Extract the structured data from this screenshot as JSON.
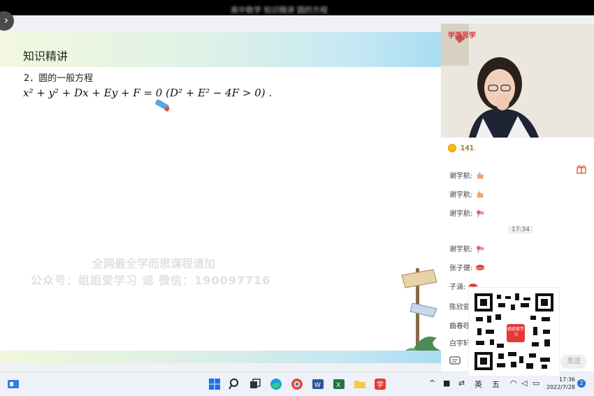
{
  "window": {
    "title": "高中数学 知识精讲 圆的方程"
  },
  "slide": {
    "header_title": "知识精讲",
    "section_heading": "2．圆的一般方程",
    "formula": "x² + y² + Dx + Ey + F = 0  (D² + E² − 4F > 0) .",
    "watermark_line1": "全网最全学而思课程请加",
    "watermark_line2": "公众号：姐姐爱学习 或 微信：190097716"
  },
  "video": {
    "overlay_label": "学而思学"
  },
  "chat": {
    "coin_count": "141",
    "messages": [
      {
        "user": "谢宇航:",
        "emoji": "thumbs-up"
      },
      {
        "user": "谢宇航:",
        "emoji": "thumbs-up"
      },
      {
        "user": "谢宇航:",
        "emoji": "flower"
      },
      {
        "user": "谢宇航:",
        "emoji": "flower"
      },
      {
        "user": "张子健:",
        "emoji": "lips"
      },
      {
        "user": "子涵:",
        "emoji": "lips"
      },
      {
        "user": "陈欣茹:",
        "emoji": ""
      },
      {
        "user": "曲春旺:",
        "emoji": ""
      },
      {
        "user": "白宇轩:",
        "emoji": ""
      }
    ],
    "time_divider": "17:34",
    "input_placeholder": "",
    "send_label": "发送"
  },
  "qr": {
    "badge_text": "姐姐爱学习"
  },
  "taskbar": {
    "lang_label": "英",
    "ime_label": "五",
    "time": "17:36",
    "date": "2022/7/28",
    "notification_count": "2"
  },
  "colors": {
    "accent_blue": "#2b6fd6",
    "header_gradient_end": "#a9dcf2",
    "coin": "#f5b90f",
    "badge_red": "#e53935"
  }
}
